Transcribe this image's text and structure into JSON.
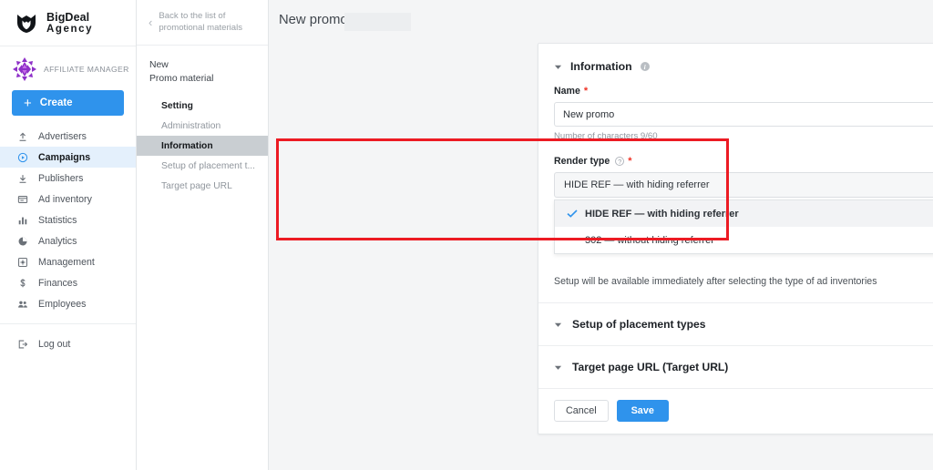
{
  "brand": {
    "name": "BigDeal",
    "subtitle": "Agency",
    "logo_icon": "shield-mask-logo"
  },
  "account": {
    "avatar_icon": "fractal-avatar",
    "label": "AFFILIATE MANAGER",
    "create_label": "Create",
    "create_icon": "plus-icon"
  },
  "sidebar": {
    "items": [
      {
        "label": "Advertisers",
        "icon": "upload-arrow-icon",
        "active": false
      },
      {
        "label": "Campaigns",
        "icon": "play-circle-icon",
        "active": true
      },
      {
        "label": "Publishers",
        "icon": "download-arrow-icon",
        "active": false
      },
      {
        "label": "Ad inventory",
        "icon": "window-icon",
        "active": false
      },
      {
        "label": "Statistics",
        "icon": "bar-chart-icon",
        "active": false
      },
      {
        "label": "Analytics",
        "icon": "pie-chart-icon",
        "active": false
      },
      {
        "label": "Management",
        "icon": "settings-square-icon",
        "active": false
      },
      {
        "label": "Finances",
        "icon": "dollar-icon",
        "active": false
      },
      {
        "label": "Employees",
        "icon": "people-icon",
        "active": false
      }
    ],
    "logout": {
      "label": "Log out",
      "icon": "logout-icon"
    }
  },
  "subnav": {
    "back_link": "Back to the list of promotional materials",
    "back_icon": "chevron-left-icon",
    "title_line1": "New",
    "title_line2": "Promo material",
    "items": [
      {
        "label": "Setting",
        "style": "head",
        "selected": false
      },
      {
        "label": "Administration",
        "style": "normal",
        "selected": false
      },
      {
        "label": "Information",
        "style": "normal",
        "selected": true
      },
      {
        "label": "Setup of placement t...",
        "style": "normal",
        "selected": false
      },
      {
        "label": "Target page URL",
        "style": "normal",
        "selected": false
      }
    ]
  },
  "header": {
    "page_title": "New promo"
  },
  "form": {
    "section_title": "Information",
    "section_caret_icon": "caret-down-icon",
    "section_info_icon": "info-circle-icon",
    "name": {
      "label": "Name",
      "required_mark": "*",
      "value": "New promo",
      "placeholder": "Name",
      "char_count": "Number of characters 9/60"
    },
    "render_type": {
      "label": "Render type",
      "help_icon": "question-circle-icon",
      "required_mark": "*",
      "selected": "HIDE REF — with hiding referrer",
      "chevron_icon": "chevron-down-icon",
      "options": [
        {
          "label": "HIDE REF — with hiding referrer",
          "selected": true,
          "icon": "check-icon"
        },
        {
          "label": "302 — without hiding referrer",
          "selected": false,
          "icon": ""
        }
      ]
    },
    "hint": "Setup will be available immediately after selecting the type of ad inventories",
    "sections": [
      {
        "label": "Setup of placement types",
        "caret_icon": "caret-down-icon"
      },
      {
        "label": "Target page URL (Target URL)",
        "caret_icon": "caret-down-icon"
      }
    ],
    "cancel_label": "Cancel",
    "save_label": "Save"
  },
  "annotations": {
    "highlight_box": "render-type-red-highlight",
    "cursor_marker": "red-cursor-dot"
  },
  "colors": {
    "accent_blue": "#2f93ec",
    "highlight_red": "#ec1b23",
    "active_nav_bg": "#e4f0fc",
    "selected_subnav_bg": "#c9ced2",
    "required_red": "#ef3124"
  }
}
